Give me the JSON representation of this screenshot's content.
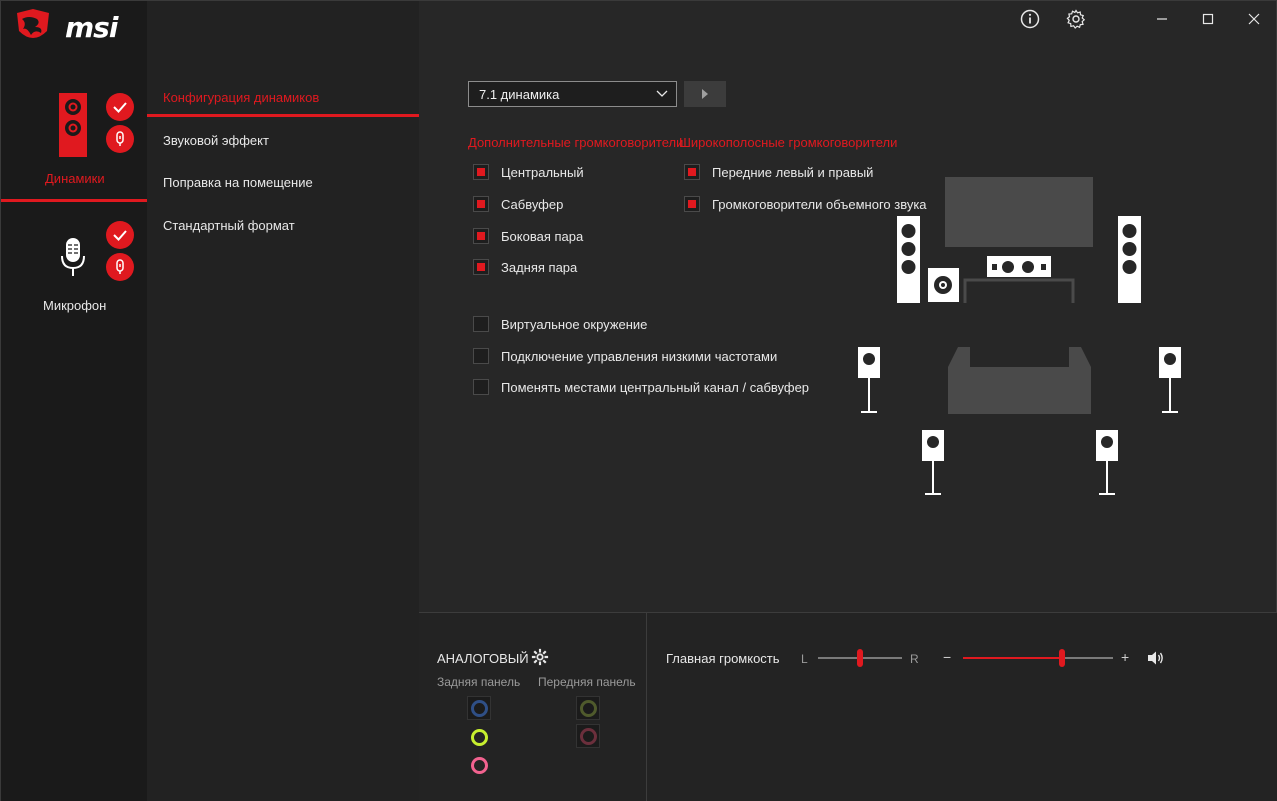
{
  "app": {
    "brand": "msi"
  },
  "titlebar": {
    "info_icon": "info-circle-icon",
    "settings_icon": "gear-icon",
    "minimize": "–",
    "maximize": "☐",
    "close": "✕"
  },
  "devices": [
    {
      "label": "Динамики",
      "active": true
    },
    {
      "label": "Микрофон",
      "active": false
    }
  ],
  "menu": {
    "items": [
      {
        "label": "Конфигурация динамиков",
        "active": true
      },
      {
        "label": "Звуковой эффект",
        "active": false
      },
      {
        "label": "Поправка на помещение",
        "active": false
      },
      {
        "label": "Стандартный формат",
        "active": false
      }
    ]
  },
  "speaker_config": {
    "selected": "7.1 динамика",
    "optional_title": "Дополнительные громкоговорители",
    "fullrange_title": "Широкополосные громкоговорители",
    "optional": [
      {
        "label": "Центральный",
        "checked": true
      },
      {
        "label": "Сабвуфер",
        "checked": true
      },
      {
        "label": "Боковая пара",
        "checked": true
      },
      {
        "label": "Задняя пара",
        "checked": true
      }
    ],
    "fullrange": [
      {
        "label": "Передние левый и правый",
        "checked": true
      },
      {
        "label": "Громкоговорители объемного звука",
        "checked": true
      }
    ],
    "options": [
      {
        "label": "Виртуальное окружение",
        "checked": false
      },
      {
        "label": "Подключение управления низкими частотами",
        "checked": false
      },
      {
        "label": "Поменять местами центральный канал / сабвуфер",
        "checked": false
      }
    ]
  },
  "analog": {
    "title": "АНАЛОГОВЫЙ",
    "rear_label": "Задняя панель",
    "front_label": "Передняя панель",
    "rear_jacks": [
      "#2f4f86",
      "#c7ef2f",
      "#f2628f"
    ],
    "front_jacks": [
      "#4f5a2c",
      "#6b2f3c"
    ]
  },
  "volume": {
    "label": "Главная громкость",
    "balance_left": "L",
    "balance_right": "R",
    "minus": "−",
    "plus": "+",
    "balance_level": 0.5,
    "master_level": 0.66
  },
  "colors": {
    "accent": "#e0191f",
    "background": "#272727"
  }
}
